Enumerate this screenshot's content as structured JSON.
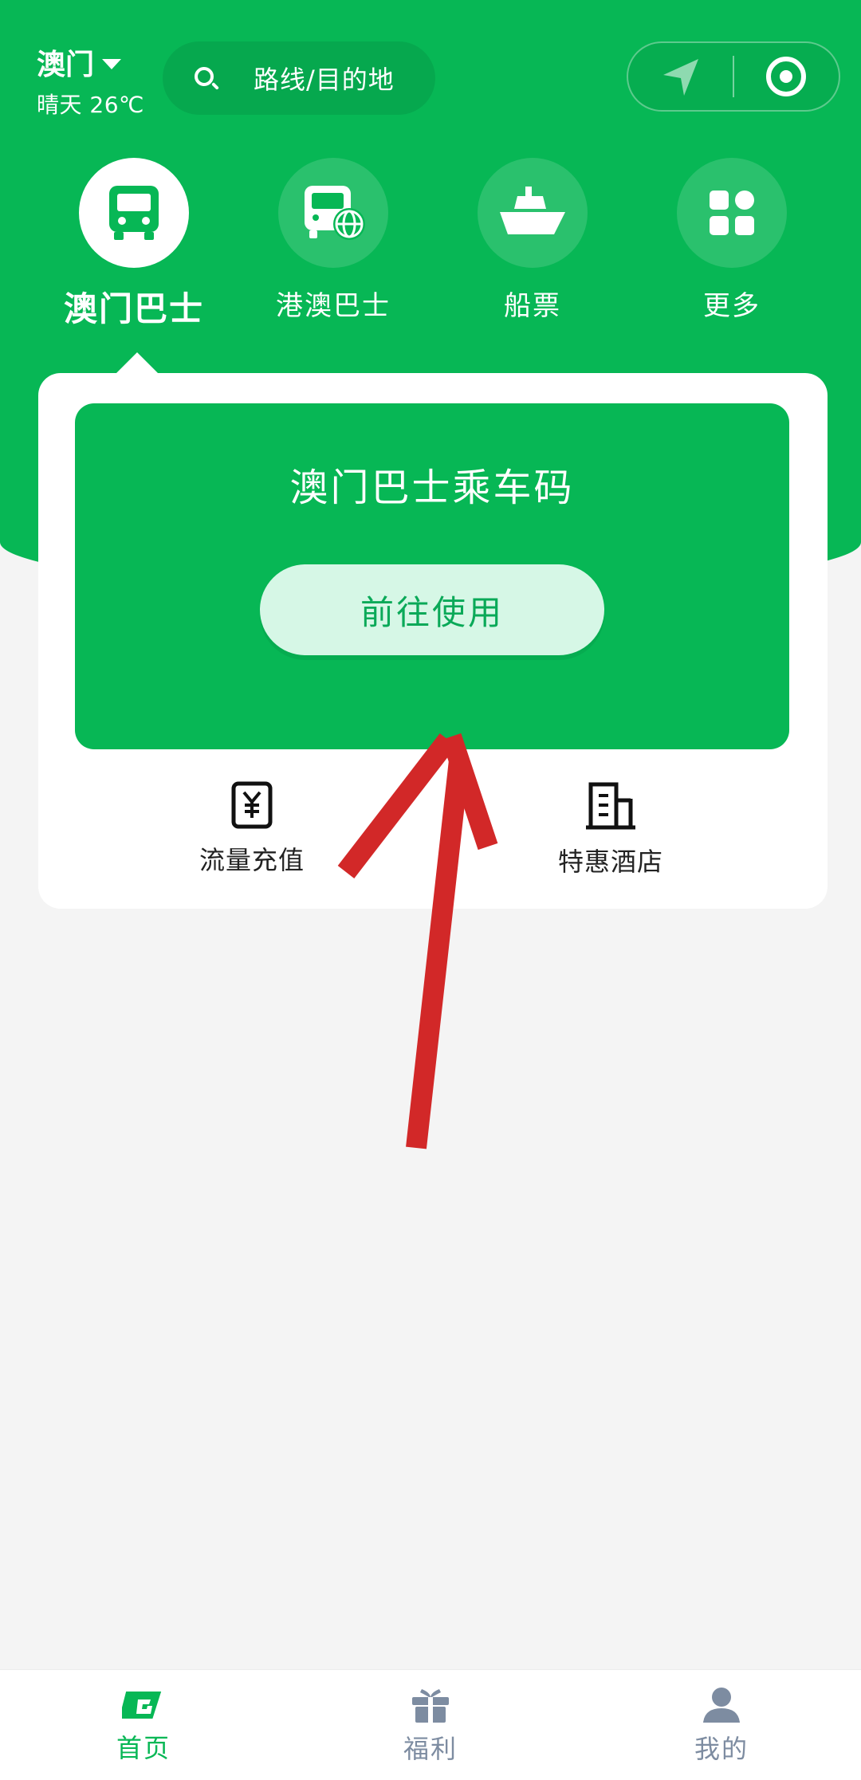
{
  "header": {
    "city": "澳门",
    "weather": "晴天 26℃",
    "search_placeholder": "路线/目的地"
  },
  "nav": {
    "items": [
      {
        "label": "澳门巴士",
        "icon": "bus-icon",
        "active": true
      },
      {
        "label": "港澳巴士",
        "icon": "cross-border-bus-icon",
        "active": false
      },
      {
        "label": "船票",
        "icon": "ferry-icon",
        "active": false
      },
      {
        "label": "更多",
        "icon": "grid-icon",
        "active": false
      }
    ]
  },
  "card": {
    "title": "澳门巴士乘车码",
    "button_label": "前往使用",
    "quick_actions": [
      {
        "label": "流量充值",
        "icon": "phone-topup-icon"
      },
      {
        "label": "特惠酒店",
        "icon": "hotel-icon"
      }
    ]
  },
  "tabbar": {
    "items": [
      {
        "label": "首页",
        "icon": "home-logo-icon",
        "active": true
      },
      {
        "label": "福利",
        "icon": "gift-icon",
        "active": false
      },
      {
        "label": "我的",
        "icon": "user-icon",
        "active": false
      }
    ]
  },
  "colors": {
    "brand_green": "#07b755",
    "button_bg": "#d6f7e6",
    "annotation_red": "#d22828",
    "tab_inactive": "#7d8ca1"
  }
}
